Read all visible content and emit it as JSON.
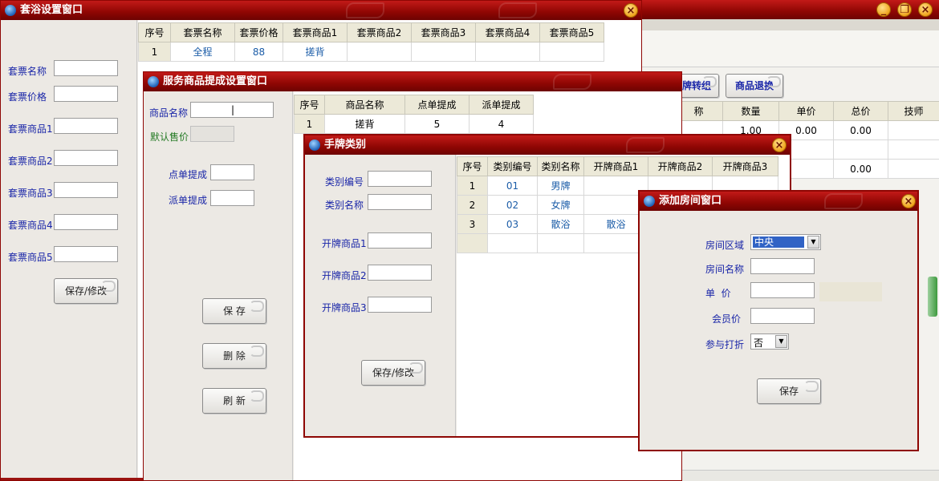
{
  "main": {
    "tabs": [
      "牌转组",
      "商品退换"
    ],
    "columns": [
      "称",
      "数量",
      "单价",
      "总价",
      "技师"
    ],
    "rows": [
      [
        "",
        "1.00",
        "0.00",
        "0.00",
        ""
      ],
      [
        "",
        "",
        "",
        "",
        ""
      ],
      [
        "",
        "",
        "",
        "0.00",
        ""
      ]
    ],
    "scroll_text": "'''"
  },
  "taoyu": {
    "title": "套浴设置窗口",
    "labels": [
      "套票名称",
      "套票价格",
      "套票商品1",
      "套票商品2",
      "套票商品3",
      "套票商品4",
      "套票商品5"
    ],
    "button": "保存/修改",
    "columns": [
      "序号",
      "套票名称",
      "套票价格",
      "套票商品1",
      "套票商品2",
      "套票商品3",
      "套票商品4",
      "套票商品5"
    ],
    "rows": [
      [
        "1",
        "全程",
        "88",
        "搓背",
        "",
        "",
        "",
        ""
      ]
    ]
  },
  "fuwu": {
    "title": "服务商品提成设置窗口",
    "name_label": "商品名称",
    "price_label": "默认售价",
    "dian_label": "点单提成",
    "pai_label": "派单提成",
    "buttons": [
      "保 存",
      "删 除",
      "刷 新"
    ],
    "columns": [
      "序号",
      "商品名称",
      "点单提成",
      "派单提成"
    ],
    "rows": [
      [
        "1",
        "搓背",
        "5",
        "4"
      ]
    ]
  },
  "shoupai": {
    "title": "手牌类别",
    "labels": [
      "类别编号",
      "类别名称",
      "开牌商品1",
      "开牌商品2",
      "开牌商品3"
    ],
    "button": "保存/修改",
    "columns": [
      "序号",
      "类别编号",
      "类别名称",
      "开牌商品1",
      "开牌商品2",
      "开牌商品3"
    ],
    "rows": [
      [
        "1",
        "01",
        "男牌",
        "",
        "",
        ""
      ],
      [
        "2",
        "02",
        "女牌",
        "",
        "",
        ""
      ],
      [
        "3",
        "03",
        "散浴",
        "散浴",
        "",
        ""
      ]
    ]
  },
  "room": {
    "title": "添加房间窗口",
    "area_label": "房间区域",
    "area_value": "中央",
    "name_label": "房间名称",
    "price_label": "单  价",
    "member_label": "会员价",
    "discount_label": "参与打折",
    "discount_value": "否",
    "save": "保存"
  },
  "colors": {
    "title_red": "#8e0603",
    "label_blue": "#1a26a8",
    "label_green": "#247a24",
    "cell_blue": "#1c5da8"
  }
}
